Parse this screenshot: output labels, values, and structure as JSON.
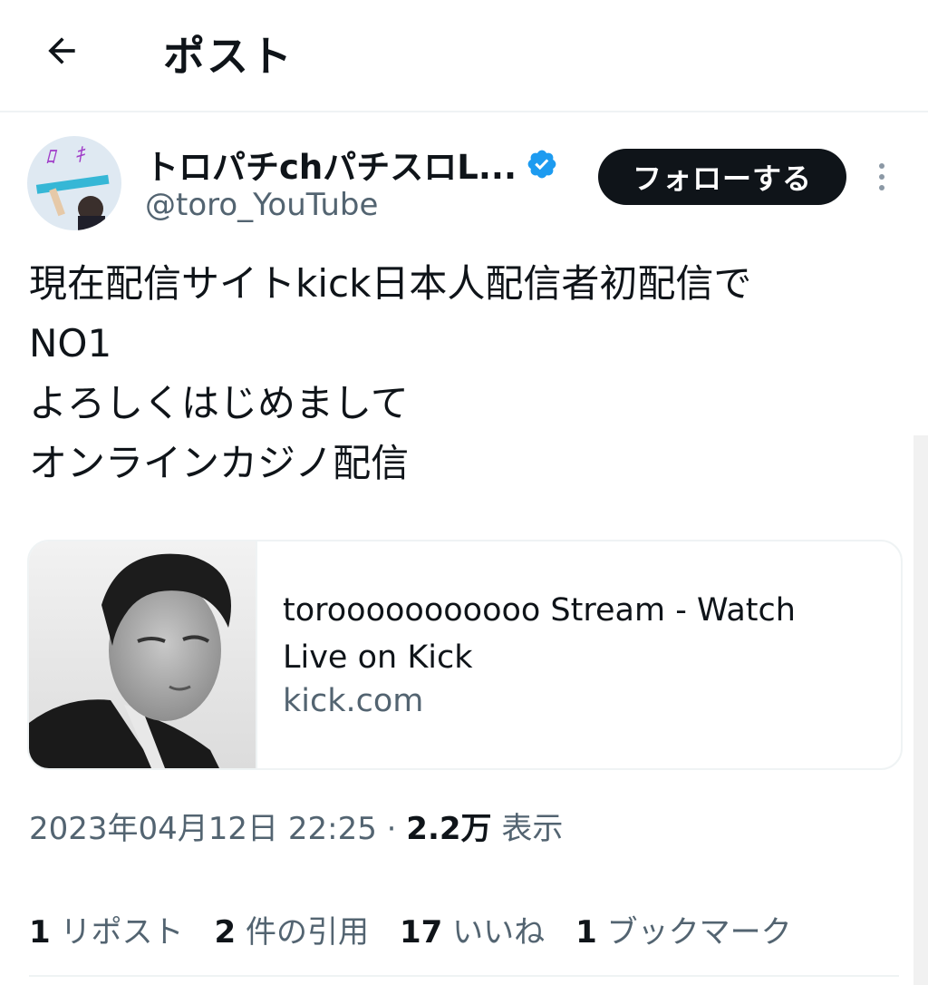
{
  "header": {
    "title": "ポスト",
    "back_icon": "arrow-left-icon"
  },
  "author": {
    "display_name": "トロパチchパチスロL...",
    "handle": "@toro_YouTube",
    "verified_icon": "verified-badge-icon",
    "verified_color": "#1d9bf0",
    "follow_label": "フォローする",
    "more_icon": "more-vertical-icon"
  },
  "tweet": {
    "lines": [
      "現在配信サイトkick日本人配信者初配信で",
      "NO1",
      "よろしくはじめまして",
      "オンラインカジノ配信"
    ]
  },
  "card": {
    "title": "torooooooooooo Stream - Watch Live on Kick",
    "domain": "kick.com"
  },
  "meta": {
    "timestamp": "2023年04月12日 22:25",
    "separator": "·",
    "views_count": "2.2万",
    "views_label": "表示"
  },
  "stats": [
    {
      "count": "1",
      "label": "リポスト"
    },
    {
      "count": "2",
      "label": "件の引用"
    },
    {
      "count": "17",
      "label": "いいね"
    },
    {
      "count": "1",
      "label": "ブックマーク"
    }
  ],
  "colors": {
    "text": "#0f1419",
    "secondary": "#536471",
    "border": "#eff3f4"
  }
}
